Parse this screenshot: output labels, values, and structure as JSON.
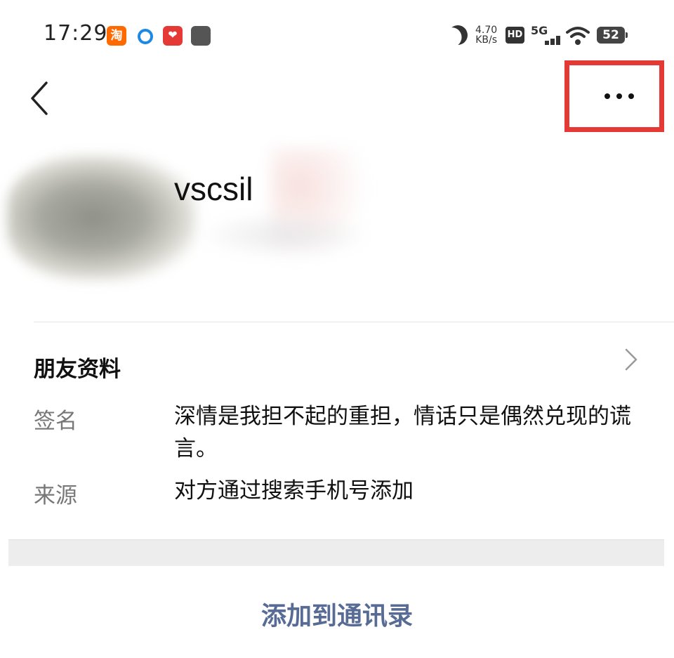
{
  "status_bar": {
    "time": "17:29",
    "taobao_glyph": "淘",
    "net_speed": "4.70",
    "net_speed_unit": "KB/s",
    "hd_label": "HD",
    "network": "5G",
    "battery": "52",
    "icons": [
      "taobao-app-icon",
      "q-app-icon",
      "red-app-icon",
      "gray-app-icon",
      "moon-icon",
      "signal-icon",
      "wifi-icon",
      "battery-icon"
    ]
  },
  "nav": {
    "back_icon": "chevron-left-icon",
    "more_icon": "more-dots-icon",
    "highlight_color": "#e53935"
  },
  "profile": {
    "name": "vscsil"
  },
  "info": {
    "section_title": "朋友资料",
    "signature_label": "签名",
    "signature_value": "深情是我担不起的重担，情话只是偶然兑现的谎言。",
    "source_label": "来源",
    "source_value": "对方通过搜索手机号添加"
  },
  "actions": {
    "add_to_contacts": "添加到通讯录",
    "link_color": "#576b95"
  }
}
